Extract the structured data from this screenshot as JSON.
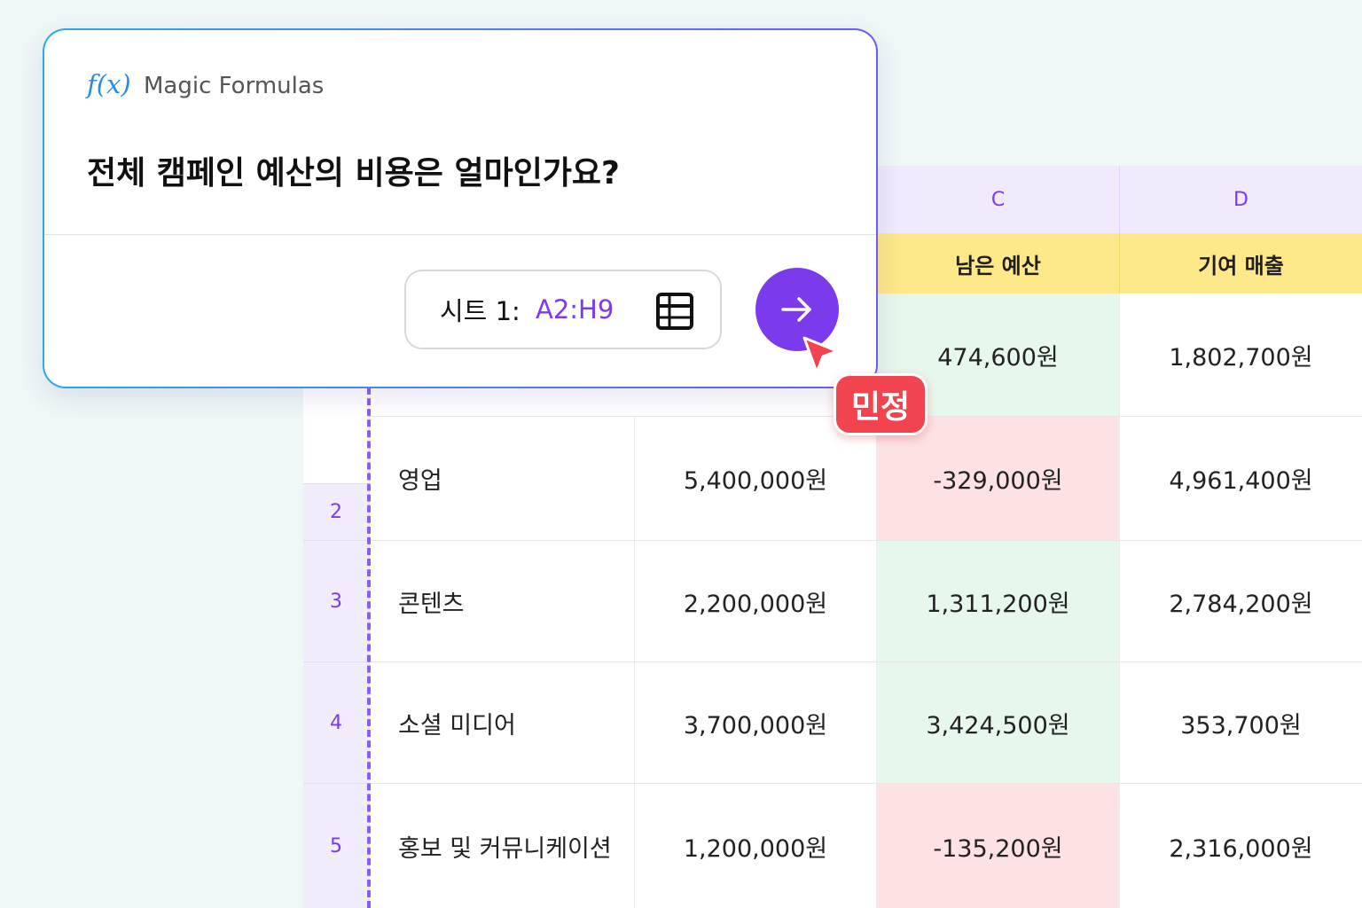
{
  "card": {
    "brand_icon": "f(x)",
    "brand": "Magic Formulas",
    "question": "전체 캠페인 예산의 비용은 얼마인가요?",
    "range_label": "시트 1:",
    "range_value": "A2:H9"
  },
  "badge": "민정",
  "sheet": {
    "columns": [
      "C",
      "D"
    ],
    "headers": [
      "남은 예산",
      "기여 매출"
    ],
    "row_first": {
      "c": "474,600원",
      "d": "1,802,700원"
    },
    "rows": [
      {
        "num": "2",
        "label": "영업",
        "b": "5,400,000원",
        "c": "-329,000원",
        "d": "4,961,400원"
      },
      {
        "num": "3",
        "label": "콘텐츠",
        "b": "2,200,000원",
        "c": "1,311,200원",
        "d": "2,784,200원"
      },
      {
        "num": "4",
        "label": "소셜 미디어",
        "b": "3,700,000원",
        "c": "3,424,500원",
        "d": "353,700원"
      },
      {
        "num": "5",
        "label": "홍보 및 커뮤니케이션",
        "b": "1,200,000원",
        "c": "-135,200원",
        "d": "2,316,000원"
      }
    ]
  },
  "colors": {
    "accent": "#7c3aed",
    "positive": "#e6f7ec",
    "negative": "#fde2e4",
    "header": "#fde88a",
    "badge": "#f2444e"
  }
}
